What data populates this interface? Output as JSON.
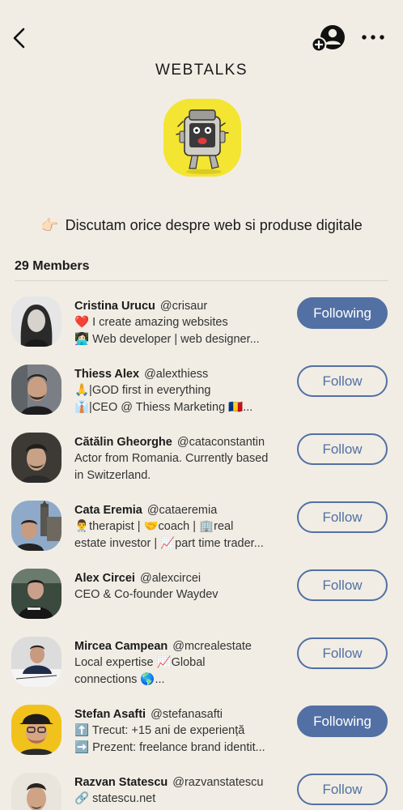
{
  "header": {
    "back_icon": "chevron-left-icon",
    "add_member_icon": "add-user-icon",
    "more_icon": "more-horizontal-icon"
  },
  "club": {
    "title": "WEBTALKS",
    "avatar_icon": "robot-icon",
    "avatar_color": "#f3e531",
    "description_emoji": "👉🏻",
    "description": "Discutam orice despre web si produse digitale"
  },
  "members_label": "29 Members",
  "colors": {
    "accent": "#5270a4",
    "background": "#f1ede4"
  },
  "members": [
    {
      "name": "Cristina Urucu",
      "handle": "@crisaur",
      "bio1": "❤️ I create amazing websites",
      "bio2": "👩🏻‍💻 Web developer | web designer...",
      "button": "Following",
      "following": true
    },
    {
      "name": "Thiess Alex",
      "handle": "@alexthiess",
      "bio1": "🙏|GOD first in everything",
      "bio2": "👔|CEO @ Thiess Marketing 🇷🇴...",
      "button": "Follow",
      "following": false
    },
    {
      "name": "Cătălin Gheorghe",
      "handle": "@cataconstantin",
      "bio1": "Actor from Romania. Currently based",
      "bio2": "in Switzerland.",
      "button": "Follow",
      "following": false
    },
    {
      "name": "Cata Eremia",
      "handle": "@cataeremia",
      "bio1": "👨‍⚕️therapist | 🤝coach | 🏢real",
      "bio2": "estate investor | 📈part time trader...",
      "button": "Follow",
      "following": false
    },
    {
      "name": "Alex Circei",
      "handle": "@alexcircei",
      "bio1": "CEO & Co-founder Waydev",
      "bio2": "",
      "button": "Follow",
      "following": false
    },
    {
      "name": "Mircea Campean",
      "handle": "@mcrealestate",
      "bio1": "Local expertise 📈Global",
      "bio2": "connections 🌎...",
      "button": "Follow",
      "following": false
    },
    {
      "name": "Stefan Asafti",
      "handle": "@stefanasafti",
      "bio1": "⬆️ Trecut: +15 ani de experiență",
      "bio2": "➡️ Prezent: freelance brand identit...",
      "button": "Following",
      "following": true
    },
    {
      "name": "Razvan Statescu",
      "handle": "@razvanstatescu",
      "bio1": "🔗 statescu.net",
      "bio2": "",
      "button": "Follow",
      "following": false
    }
  ]
}
